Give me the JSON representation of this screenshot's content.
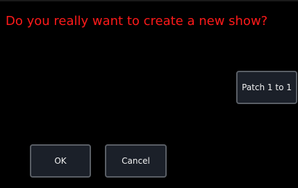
{
  "dialog": {
    "prompt": "Do you really want to create a new show?"
  },
  "buttons": {
    "patch_label": "Patch 1 to 1",
    "ok_label": "OK",
    "cancel_label": "Cancel"
  },
  "colors": {
    "background": "#000000",
    "prompt_text": "#ff1a1a",
    "button_fill": "#1b2029",
    "button_border": "#5a5f66",
    "button_text": "#f2f2f2"
  }
}
